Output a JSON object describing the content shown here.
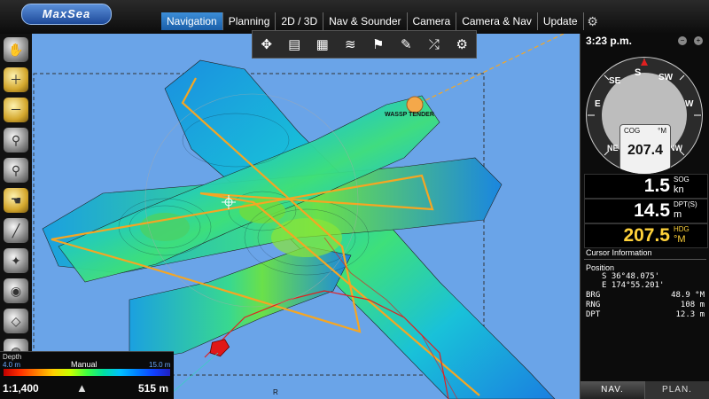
{
  "app": {
    "logo_text": "MaxSea"
  },
  "nav": {
    "tabs": [
      {
        "label": "Navigation",
        "active": true
      },
      {
        "label": "Planning"
      },
      {
        "label": "2D / 3D"
      },
      {
        "label": "Nav & Sounder"
      },
      {
        "label": "Camera"
      },
      {
        "label": "Camera & Nav"
      },
      {
        "label": "Update"
      }
    ],
    "extra_icon": "tools-icon"
  },
  "map": {
    "vessel_label": "WASSP TENDER",
    "edge_label": "R",
    "colors": {
      "water": "#6aa4e8",
      "route": "#f5a623",
      "track": "#e02020"
    }
  },
  "depth_bar": {
    "label": "Depth",
    "min": "4.0 m",
    "mode": "Manual",
    "max": "15.0 m"
  },
  "scale": {
    "ratio": "1:1,400",
    "distance": "515 m"
  },
  "right_panel": {
    "time": "3:23 p.m.",
    "compass": {
      "cog_label": "COG",
      "cog_unit": "°M",
      "cog_value": "207.4",
      "letters": [
        "N",
        "NE",
        "E",
        "SE",
        "S",
        "SW",
        "W",
        "NW"
      ]
    },
    "sog": {
      "value": "1.5",
      "label": "SOG",
      "unit": "kn"
    },
    "dpt": {
      "value": "14.5",
      "label": "DPT(S)",
      "unit": "m"
    },
    "hdg": {
      "value": "207.5",
      "label": "HDG",
      "unit": "°M"
    },
    "cursor": {
      "title": "Cursor Information",
      "position_label": "Position",
      "lat": "S 36°48.075'",
      "lon": "E 174°55.201'",
      "brg_label": "BRG",
      "brg": "48.9 °M",
      "rng_label": "RNG",
      "rng": "108 m",
      "dpt_label": "DPT",
      "dpt": "12.3 m"
    },
    "tabs": [
      "NAV.",
      "PLAN."
    ]
  }
}
